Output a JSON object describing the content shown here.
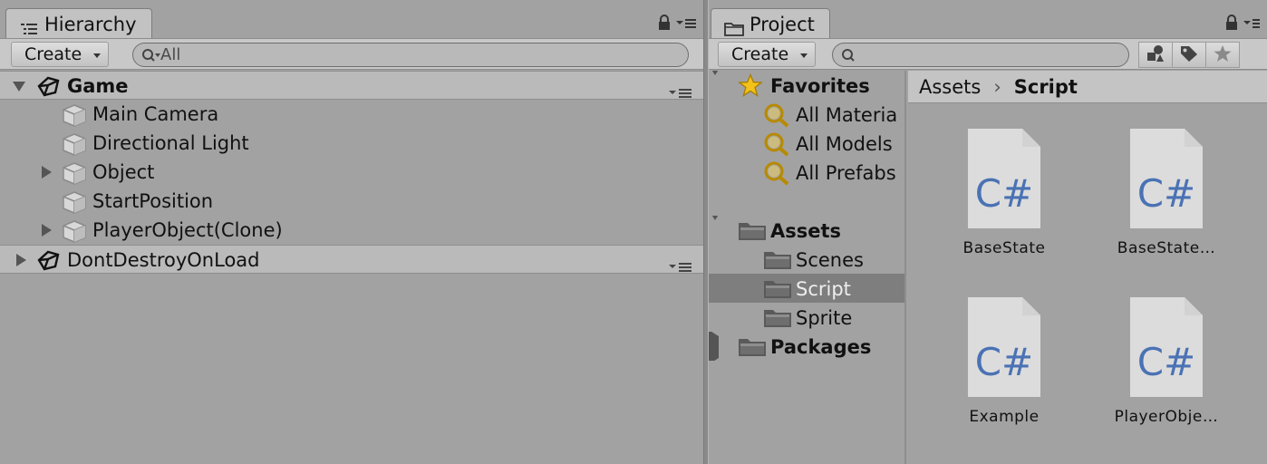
{
  "hierarchy": {
    "tab_label": "Hierarchy",
    "create_label": "Create",
    "search_placeholder": "All",
    "scenes": [
      {
        "name": "Game",
        "expanded": true
      },
      {
        "name": "DontDestroyOnLoad",
        "expanded": false
      }
    ],
    "objects": [
      {
        "name": "Main Camera",
        "has_children": false
      },
      {
        "name": "Directional Light",
        "has_children": false
      },
      {
        "name": "Object",
        "has_children": true
      },
      {
        "name": "StartPosition",
        "has_children": false
      },
      {
        "name": "PlayerObject(Clone)",
        "has_children": true
      }
    ]
  },
  "project": {
    "tab_label": "Project",
    "create_label": "Create",
    "search_placeholder": "",
    "tree": {
      "favorites_label": "Favorites",
      "favorites": [
        "All Materia",
        "All Models",
        "All Prefabs"
      ],
      "assets_label": "Assets",
      "asset_folders": [
        "Scenes",
        "Script",
        "Sprite"
      ],
      "selected_folder": "Script",
      "packages_label": "Packages"
    },
    "breadcrumb": {
      "root": "Assets",
      "separator": "›",
      "current": "Script"
    },
    "files": [
      {
        "name": "BaseState",
        "type_label": "C#"
      },
      {
        "name": "BaseState…",
        "type_label": "C#"
      },
      {
        "name": "Example",
        "type_label": "C#"
      },
      {
        "name": "PlayerObje…",
        "type_label": "C#"
      }
    ]
  },
  "icons": {
    "hierarchy_tab": "hierarchy-list-icon",
    "project_tab": "folder-icon",
    "lock": "lock-icon",
    "panel_menu": "panel-menu-icon",
    "scene": "unity-scene-icon",
    "gameobject": "cube-icon",
    "favorite": "star-icon",
    "saved_search": "search-filter-icon",
    "folder": "folder-icon"
  },
  "colors": {
    "panel_bg": "#a2a2a2",
    "toolbar_bg": "#c8c8c8",
    "selection": "#7e7e7e",
    "csharp_text": "#4a72b4",
    "file_bg": "#dcdcdc"
  }
}
